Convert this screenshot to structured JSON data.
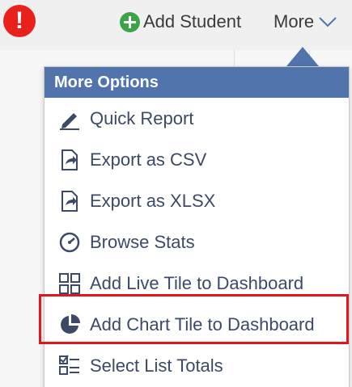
{
  "step_badge": "!",
  "toolbar": {
    "add_student_label": "Add Student",
    "more_label": "More"
  },
  "menu": {
    "header": "More Options",
    "items": [
      {
        "label": "Quick Report",
        "icon": "pencil-icon"
      },
      {
        "label": "Export as CSV",
        "icon": "export-icon"
      },
      {
        "label": "Export as XLSX",
        "icon": "export-icon"
      },
      {
        "label": "Browse Stats",
        "icon": "gauge-icon"
      },
      {
        "label": "Add Live Tile to Dashboard",
        "icon": "tiles-icon"
      },
      {
        "label": "Add Chart Tile to Dashboard",
        "icon": "pie-chart-icon"
      },
      {
        "label": "Select List Totals",
        "icon": "checklist-icon"
      }
    ]
  },
  "colors": {
    "accent": "#5274ac",
    "highlight": "#e0171b",
    "badge": "#e8211c",
    "add_icon": "#3aa447",
    "item_icon": "#3c4a66"
  }
}
